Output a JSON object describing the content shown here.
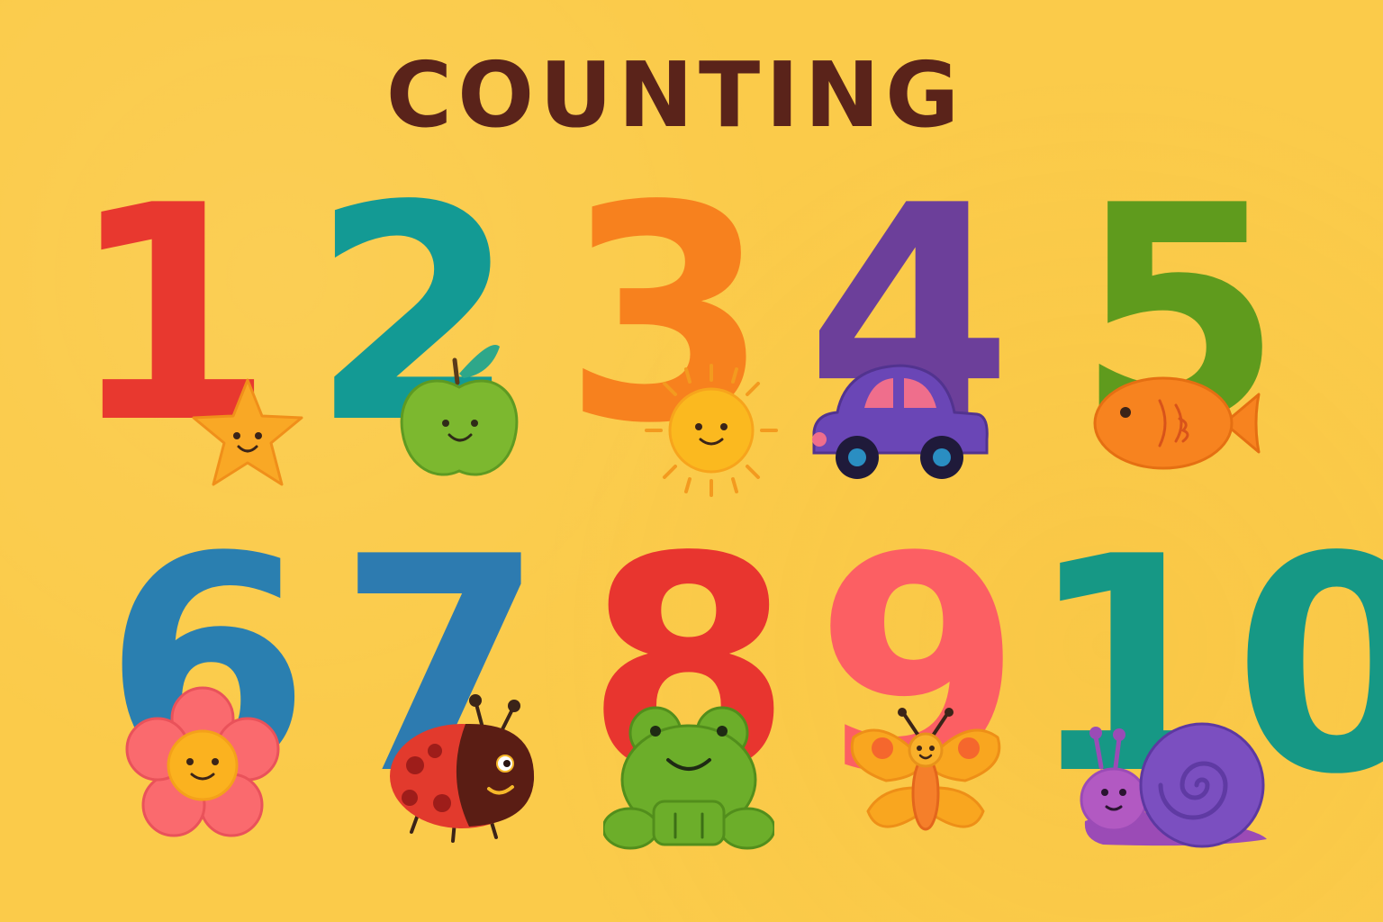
{
  "title": "COUNTING",
  "numbers": [
    {
      "label": "1",
      "color": "#e8382f",
      "critter": "star"
    },
    {
      "label": "2",
      "color": "#139a94",
      "critter": "apple"
    },
    {
      "label": "3",
      "color": "#f7811e",
      "critter": "sun"
    },
    {
      "label": "4",
      "color": "#6c3f9a",
      "critter": "car"
    },
    {
      "label": "5",
      "color": "#5f9b1d",
      "critter": "fish"
    },
    {
      "label": "6",
      "color": "#2a7fb0",
      "critter": "flower"
    },
    {
      "label": "7",
      "color": "#2d7bb0",
      "critter": "ladybug"
    },
    {
      "label": "8",
      "color": "#e8352f",
      "critter": "frog"
    },
    {
      "label": "9",
      "color": "#fc5f63",
      "critter": "butterfly"
    },
    {
      "label": "10",
      "color": "#169885",
      "critter": "snail"
    }
  ]
}
